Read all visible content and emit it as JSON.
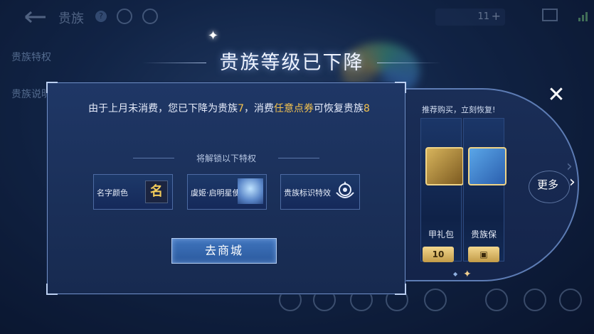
{
  "header": {
    "title": "贵族",
    "help": "?",
    "coins": "11",
    "add": "+"
  },
  "sidebar": {
    "items": [
      "贵族特权",
      "贵族说明"
    ]
  },
  "dialog": {
    "title": "贵族等级已下降",
    "message_part1": "由于上月未消费，您已下降为贵族",
    "level_now": "7",
    "message_part2": "，消费",
    "highlight": "任意点券",
    "message_part3": "可恢复贵族",
    "level_restore": "8",
    "unlock_title": "将解锁以下特权",
    "privileges": [
      {
        "label": "名字颜色",
        "icon": "name-badge-icon",
        "badge": "名"
      },
      {
        "label": "虞姬·启明星使",
        "icon": "skin-avatar-icon"
      },
      {
        "label": "贵族标识特效",
        "icon": "crest-icon"
      }
    ],
    "go_button": "去商城"
  },
  "side_panel": {
    "header": "推荐购买，立刻恢复!",
    "gifts": [
      {
        "name": "甲礼包",
        "tag": "10"
      },
      {
        "name": "贵族保",
        "tag": ""
      }
    ],
    "more": "更多",
    "more_icon": "chevron-right-icon"
  },
  "close_icon": "close-icon",
  "colors": {
    "accent_gold": "#f3c24f",
    "button_blue": "#3f74bd",
    "panel_border": "#6f8ec5"
  }
}
